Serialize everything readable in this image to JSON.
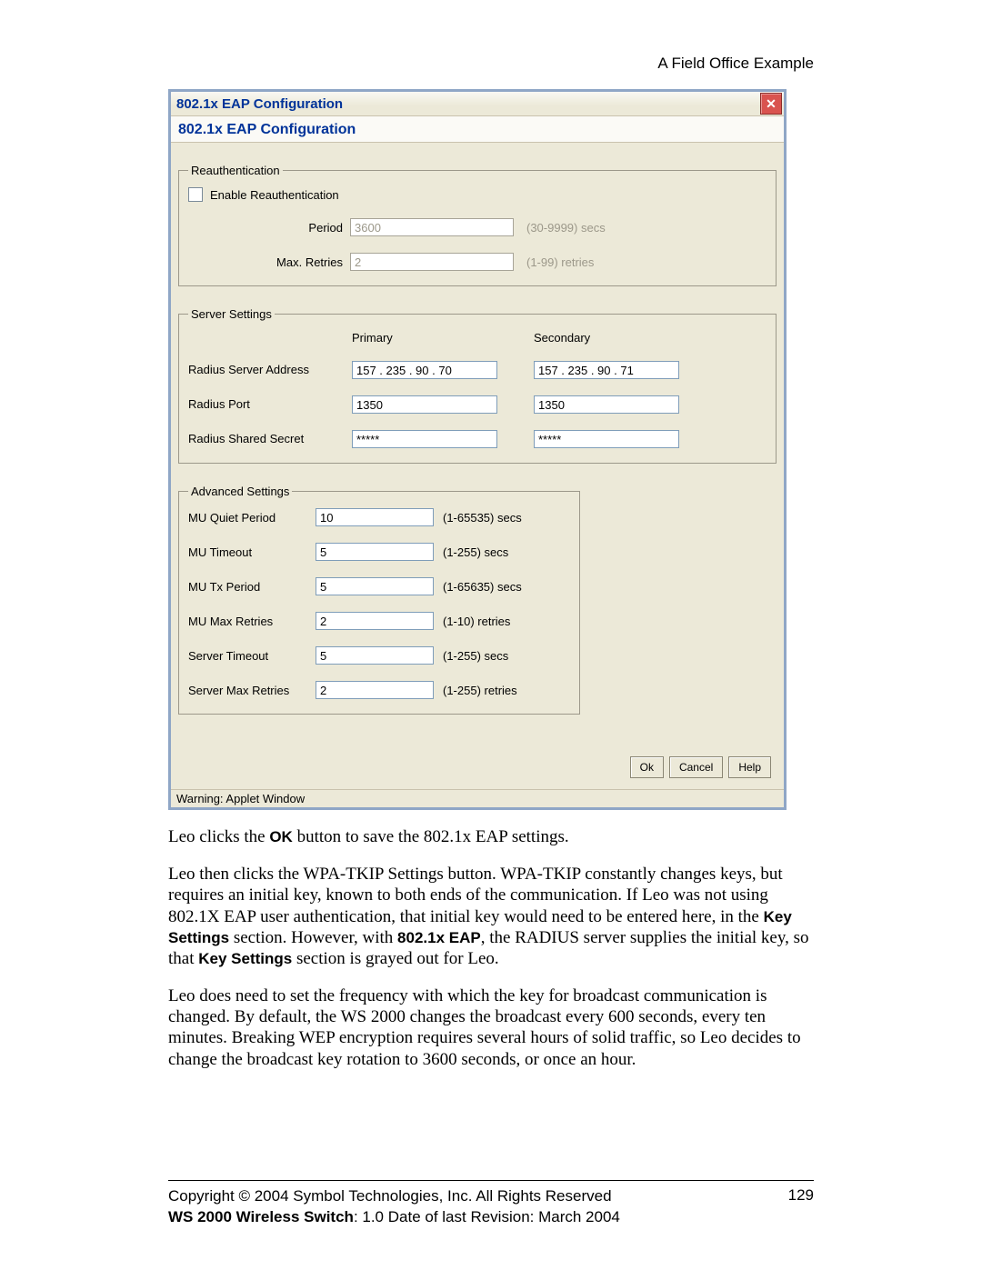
{
  "page_header": "A Field Office Example",
  "dialog": {
    "titlebar": "802.1x EAP Configuration",
    "heading": "802.1x EAP Configuration",
    "close_glyph": "✕",
    "reauth": {
      "legend": "Reauthentication",
      "enable_label": "Enable Reauthentication",
      "period_label": "Period",
      "period_value": "3600",
      "period_hint": "(30-9999) secs",
      "max_retries_label": "Max. Retries",
      "max_retries_value": "2",
      "max_retries_hint": "(1-99) retries"
    },
    "server": {
      "legend": "Server Settings",
      "col_primary": "Primary",
      "col_secondary": "Secondary",
      "addr_label": "Radius Server Address",
      "addr_primary": "157 . 235 . 90   . 70",
      "addr_secondary": "157 . 235 . 90   . 71",
      "port_label": "Radius Port",
      "port_primary": "1350",
      "port_secondary": "1350",
      "secret_label": "Radius Shared Secret",
      "secret_primary": "*****",
      "secret_secondary": "*****"
    },
    "adv": {
      "legend": "Advanced Settings",
      "rows": [
        {
          "label": "MU Quiet Period",
          "value": "10",
          "hint": "(1-65535) secs"
        },
        {
          "label": "MU Timeout",
          "value": "5",
          "hint": "(1-255) secs"
        },
        {
          "label": "MU Tx Period",
          "value": "5",
          "hint": "(1-65635) secs"
        },
        {
          "label": "MU Max Retries",
          "value": "2",
          "hint": "(1-10) retries"
        },
        {
          "label": "Server Timeout",
          "value": "5",
          "hint": "(1-255) secs"
        },
        {
          "label": "Server Max Retries",
          "value": "2",
          "hint": "(1-255) retries"
        }
      ]
    },
    "buttons": {
      "ok": "Ok",
      "cancel": "Cancel",
      "help": "Help"
    },
    "statusbar": "Warning: Applet Window"
  },
  "body_text": {
    "p1_a": "Leo clicks the ",
    "p1_b": "OK",
    "p1_c": " button to save the 802.1x EAP settings.",
    "p2_a": "Leo then clicks the WPA-TKIP Settings button. WPA-TKIP constantly changes keys, but requires an initial key, known to both ends of the communication. If Leo was not using 802.1X EAP user authentication, that initial key would need to be entered here, in the ",
    "p2_b": "Key Settings",
    "p2_c": " section. However, with ",
    "p2_d": "802.1x EAP",
    "p2_e": ", the RADIUS server supplies the initial key, so that ",
    "p2_f": "Key Settings",
    "p2_g": " section is grayed out for Leo.",
    "p3": "Leo does need to set the frequency with which the key for broadcast communication is changed. By default, the WS 2000 changes the broadcast every 600 seconds, every ten minutes. Breaking WEP encryption requires several hours of solid traffic, so Leo decides to change the broadcast key rotation to 3600 seconds, or once an hour."
  },
  "footer": {
    "line1": "Copyright © 2004 Symbol Technologies, Inc. All Rights Reserved",
    "line2_a": "WS 2000 Wireless Switch",
    "line2_b": ": 1.0  Date of last Revision: March 2004",
    "page_no": "129"
  }
}
